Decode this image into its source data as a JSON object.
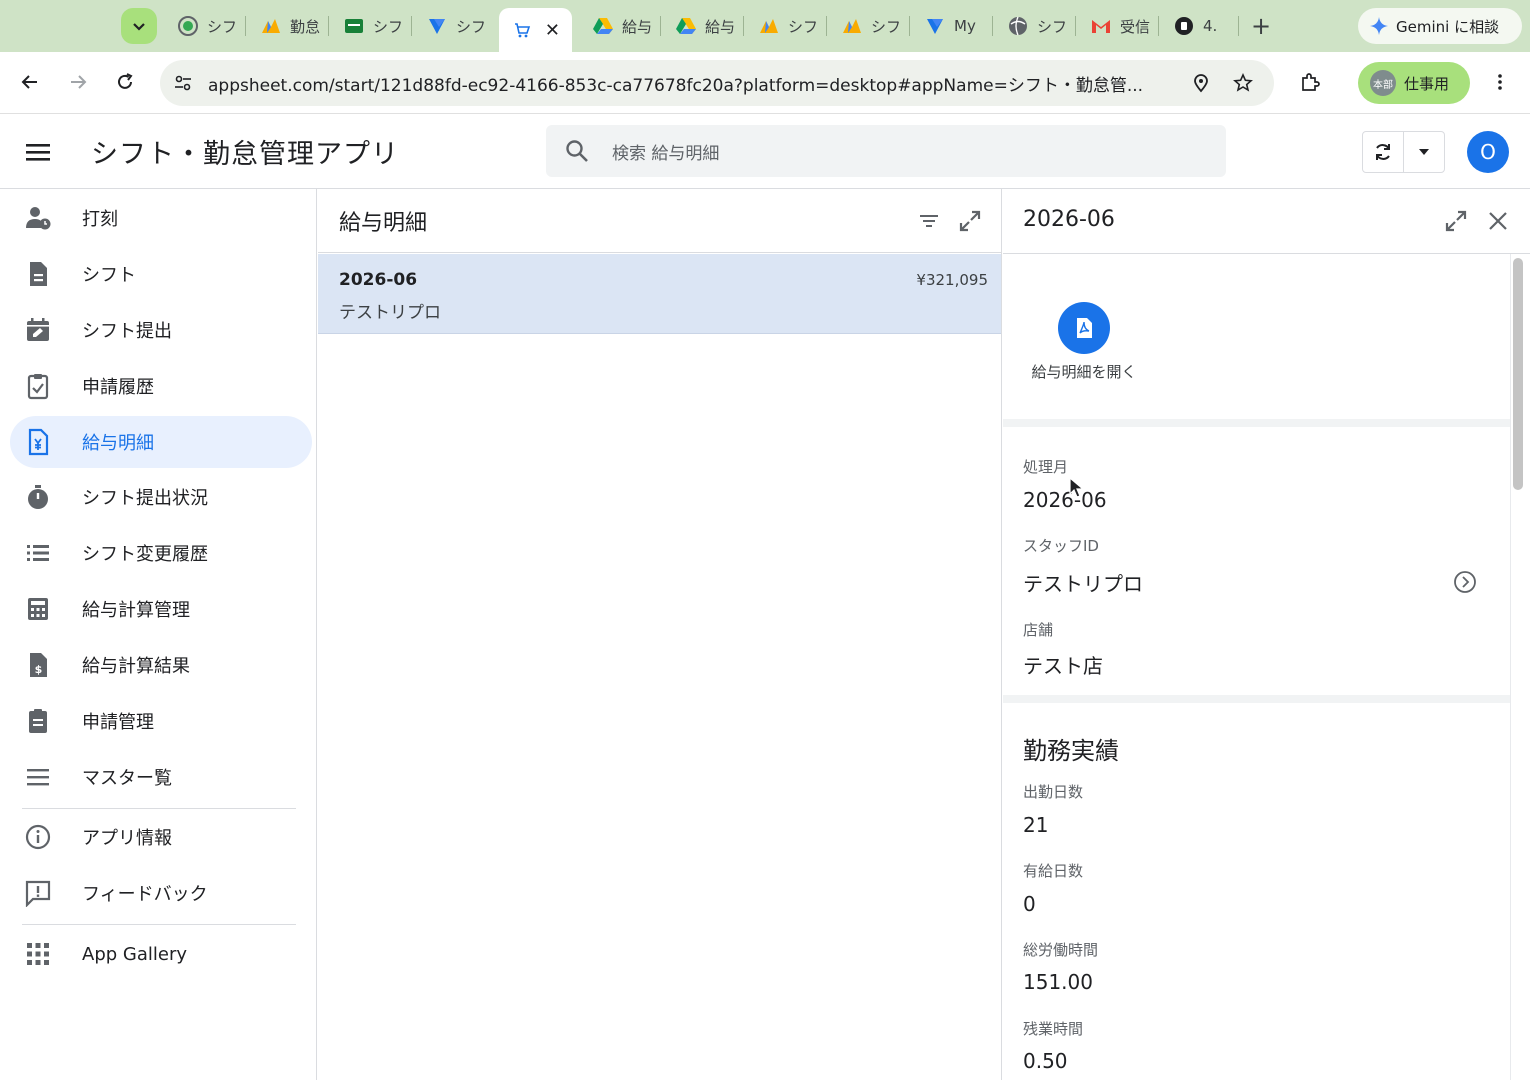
{
  "browser": {
    "tabs": [
      {
        "icon": "appsheet-loading-icon",
        "label": "シフ"
      },
      {
        "icon": "appsheet-icon",
        "label": "勤怠"
      },
      {
        "icon": "sheets-icon",
        "label": "シフ"
      },
      {
        "icon": "appsheet-blue-icon",
        "label": "シフ"
      },
      {
        "icon": "cart-icon",
        "label": "",
        "active": true
      },
      {
        "icon": "drive-icon",
        "label": "給与"
      },
      {
        "icon": "drive-icon",
        "label": "給与"
      },
      {
        "icon": "appsheet-icon",
        "label": "シフ"
      },
      {
        "icon": "appsheet-icon",
        "label": "シフ"
      },
      {
        "icon": "appsheet-blue-icon",
        "label": "My"
      },
      {
        "icon": "globe-icon",
        "label": "シフ"
      },
      {
        "icon": "gmail-icon",
        "label": "受信"
      },
      {
        "icon": "black-circle-icon",
        "label": "4."
      }
    ],
    "gemini_label": "Gemini に相談",
    "url": "appsheet.com/start/121d88fd-ec92-4166-853c-ca77678fc20a?platform=desktop#appName=シフト・勤怠管...",
    "profile_badge": "本部",
    "profile_label": "仕事用"
  },
  "app": {
    "title": "シフト・勤怠管理アプリ",
    "search_placeholder": "検索 給与明細",
    "user_initial": "O"
  },
  "nav": {
    "items": [
      {
        "label": "打刻",
        "icon": "person-clock-icon"
      },
      {
        "label": "シフト",
        "icon": "document-icon"
      },
      {
        "label": "シフト提出",
        "icon": "calendar-edit-icon"
      },
      {
        "label": "申請履歴",
        "icon": "clipboard-check-icon"
      },
      {
        "label": "給与明細",
        "icon": "document-yen-icon",
        "active": true
      },
      {
        "label": "シフト提出状況",
        "icon": "stopwatch-icon"
      },
      {
        "label": "シフト変更履歴",
        "icon": "list-icon"
      },
      {
        "label": "給与計算管理",
        "icon": "calculator-icon"
      },
      {
        "label": "給与計算結果",
        "icon": "document-dollar-icon"
      },
      {
        "label": "申請管理",
        "icon": "clipboard-list-icon"
      },
      {
        "label": "マスター覧",
        "icon": "menu-lines-icon"
      }
    ],
    "secondary": [
      {
        "label": "アプリ情報",
        "icon": "info-icon"
      },
      {
        "label": "フィードバック",
        "icon": "feedback-icon"
      }
    ],
    "gallery": {
      "label": "App Gallery",
      "icon": "grid-icon"
    }
  },
  "list": {
    "title": "給与明細",
    "rows": [
      {
        "month": "2026-06",
        "staff": "テストリプロ",
        "amount": "¥321,095"
      }
    ]
  },
  "detail": {
    "title": "2026-06",
    "pdf_action_label": "給与明細を開く",
    "fields": [
      {
        "label": "処理月",
        "value": "2026-06"
      },
      {
        "label": "スタッフID",
        "value": "テストリプロ"
      },
      {
        "label": "店舗",
        "value": "テスト店"
      }
    ],
    "section_title": "勤務実績",
    "work_fields": [
      {
        "label": "出勤日数",
        "value": "21"
      },
      {
        "label": "有給日数",
        "value": "0"
      },
      {
        "label": "総労働時間",
        "value": "151.00"
      },
      {
        "label": "残業時間",
        "value": "0.50"
      }
    ]
  }
}
